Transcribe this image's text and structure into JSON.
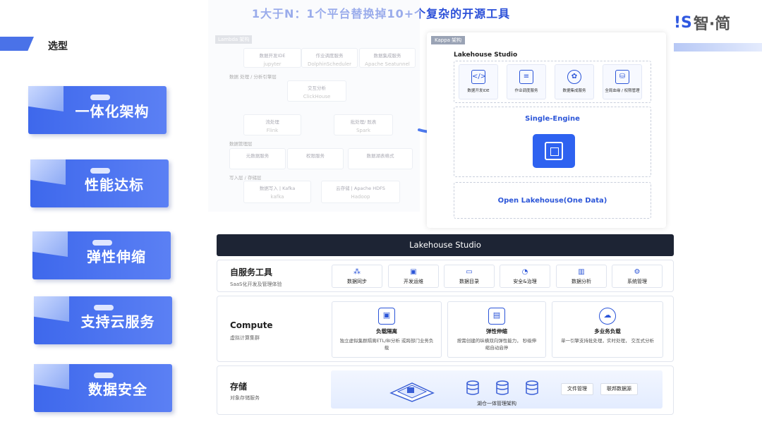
{
  "header": {
    "title": "1大于N：1个平台替换掉10+个复杂的开源工具",
    "logo_mark": "!S",
    "logo_text": "智·简",
    "section_label": "选型"
  },
  "features": [
    {
      "label": "一体化架构"
    },
    {
      "label": "性能达标"
    },
    {
      "label": "弹性伸缩"
    },
    {
      "label": "支持云服务"
    },
    {
      "label": "数据安全"
    }
  ],
  "lambda": {
    "tag": "Lambda 架构",
    "boxes": [
      {
        "title": "数据开发IDE",
        "sub": "jupyter"
      },
      {
        "title": "作业调度服务",
        "sub": "DolphinScheduler"
      },
      {
        "title": "数据集成服务",
        "sub": "Apache Seatunnel"
      },
      {
        "title": "交互分析",
        "sub": "ClickHouse"
      },
      {
        "title": "流处理",
        "sub": "Flink"
      },
      {
        "title": "批处理/ 既表",
        "sub": "Spark"
      },
      {
        "title": "元数据服务",
        "sub": ""
      },
      {
        "title": "权限服务",
        "sub": ""
      },
      {
        "title": "数据湖表格式",
        "sub": ""
      },
      {
        "title": "数据写入 | Kafka",
        "sub": "kafka"
      },
      {
        "title": "云存储 | Apache HDFS",
        "sub": "Hadoop"
      }
    ],
    "labels": [
      "数据 处理 / 分析引擎层",
      "数据管理层",
      "写入层 / 存储层"
    ]
  },
  "kappa": {
    "tag": "Kappa 架构",
    "studio": "Lakehouse Studio",
    "icons": [
      {
        "label": "数据开发IDE",
        "icon": "code-icon"
      },
      {
        "label": "作业调度服务",
        "icon": "sliders-icon"
      },
      {
        "label": "数据集成服务",
        "icon": "network-icon"
      },
      {
        "label": "全局血缘 / 权限管理",
        "icon": "database-lock-icon"
      }
    ],
    "engine": "Single-Engine",
    "open_lakehouse": "Open Lakehouse(One Data)"
  },
  "architecture": {
    "studio_bar": "Lakehouse Studio",
    "self_service": {
      "title": "自服务工具",
      "subtitle": "SaaS化开发及管理体验",
      "tools": [
        {
          "label": "数据同步",
          "icon": "sync-icon"
        },
        {
          "label": "开发运维",
          "icon": "devops-icon"
        },
        {
          "label": "数据目录",
          "icon": "folder-icon"
        },
        {
          "label": "安全&治理",
          "icon": "shield-icon"
        },
        {
          "label": "数据分析",
          "icon": "bar-chart-icon"
        },
        {
          "label": "系统管理",
          "icon": "settings-icon"
        }
      ]
    },
    "compute": {
      "title": "Compute",
      "subtitle": "虚拟计算集群",
      "cards": [
        {
          "title": "负载隔离",
          "desc": "独立虚拟集群隔离ETL/BI分析 或跨部门业务负载",
          "icon": "chip-icon"
        },
        {
          "title": "弹性伸缩",
          "desc": "按需创建的纵横双向弹性能力， 秒级伸缩自动启停",
          "icon": "elastic-icon"
        },
        {
          "title": "多业务负载",
          "desc": "单一引擎支持批处理，实时处理， 交互式分析",
          "icon": "cloud-icon"
        }
      ]
    },
    "storage": {
      "title": "存储",
      "subtitle": "对象存储服务",
      "caption": "湖仓一体管理架构",
      "buttons": [
        "文件管理",
        "联邦数据源"
      ]
    }
  },
  "colors": {
    "accent": "#2b55d8",
    "card_blue": "#3e68ec",
    "dark_bar": "#1d2434"
  }
}
